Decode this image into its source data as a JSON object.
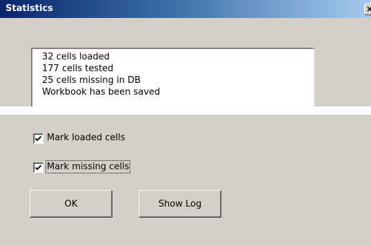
{
  "window": {
    "title": "Statistics",
    "close_glyph": "×"
  },
  "log": {
    "lines": [
      "32 cells loaded",
      "177 cells tested",
      "25 cells missing in DB",
      "Workbook has been saved"
    ]
  },
  "options": {
    "mark_loaded": {
      "label": "Mark loaded cells",
      "checked": true
    },
    "mark_missing": {
      "label": "Mark missing cells",
      "checked": true
    }
  },
  "buttons": {
    "ok": "OK",
    "show_log": "Show Log"
  },
  "colors": {
    "dialog_bg": "#d4d0c8",
    "title_start": "#0a246a",
    "title_end": "#a6caf0"
  }
}
